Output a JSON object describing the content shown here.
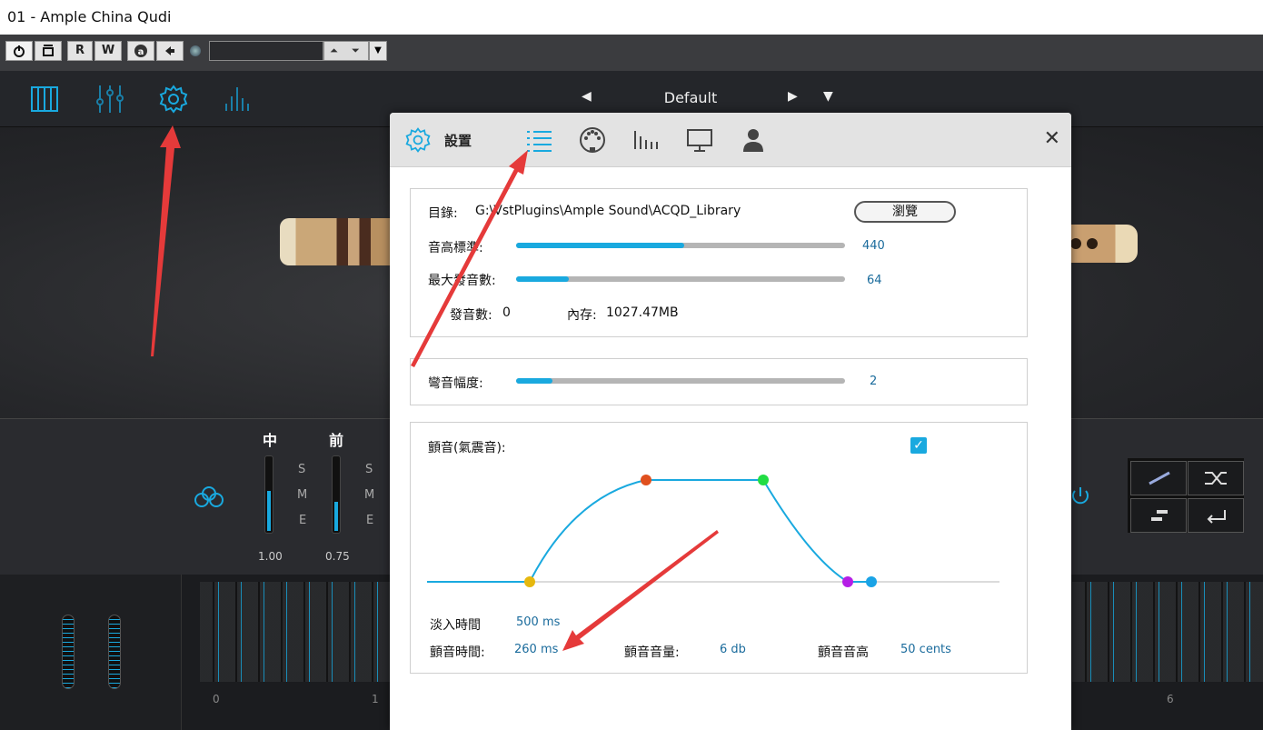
{
  "window": {
    "title": "01 - Ample China Qudi"
  },
  "toolbar": {
    "read_label": "R",
    "write_label": "W",
    "spin_up": "⏶",
    "spin_down": "⏷",
    "dropdown": "▼"
  },
  "preset": {
    "name": "Default",
    "prev": "◀",
    "next": "▶",
    "menu": "▼"
  },
  "mixer": {
    "channels": [
      {
        "name": "中",
        "value": "1.00",
        "level": 0.55
      },
      {
        "name": "前",
        "value": "0.75",
        "level": 0.4
      }
    ],
    "sme": [
      "S",
      "M",
      "E"
    ]
  },
  "keyboard": {
    "labels": [
      "0",
      "1",
      "6"
    ]
  },
  "settings": {
    "title": "設置",
    "close": "✕",
    "directory_label": "目錄:",
    "directory_value": "G:\\VstPlugins\\Ample Sound\\ACQD_Library",
    "browse_label": "瀏覽",
    "pitch_label": "音高標準:",
    "pitch_value": "440",
    "pitch_level": 0.51,
    "maxvoices_label": "最大發音數:",
    "maxvoices_value": "64",
    "maxvoices_level": 0.16,
    "voices_label": "發音數:",
    "voices_value": "0",
    "memory_label": "內存:",
    "memory_value": "1027.47MB",
    "bend_label": "彎音幅度:",
    "bend_value": "2",
    "bend_level": 0.11,
    "vibrato_label": "顫音(氣震音):",
    "vibrato_check": "✓",
    "fadein_label": "淡入時間",
    "fadein_value": "500 ms",
    "vibtime_label": "顫音時間:",
    "vibtime_value": "260 ms",
    "vibvol_label": "顫音音量:",
    "vibvol_value": "6 db",
    "vibpitch_label": "顫音音高",
    "vibpitch_value": "50 cents"
  },
  "colors": {
    "accent": "#19a9df",
    "point_start": "#e6b80e",
    "point_peak_start": "#e0501e",
    "point_peak_end": "#22dd44",
    "point_release": "#b51ee6",
    "point_end": "#1aa3e6",
    "arrow": "#e53a3a"
  }
}
